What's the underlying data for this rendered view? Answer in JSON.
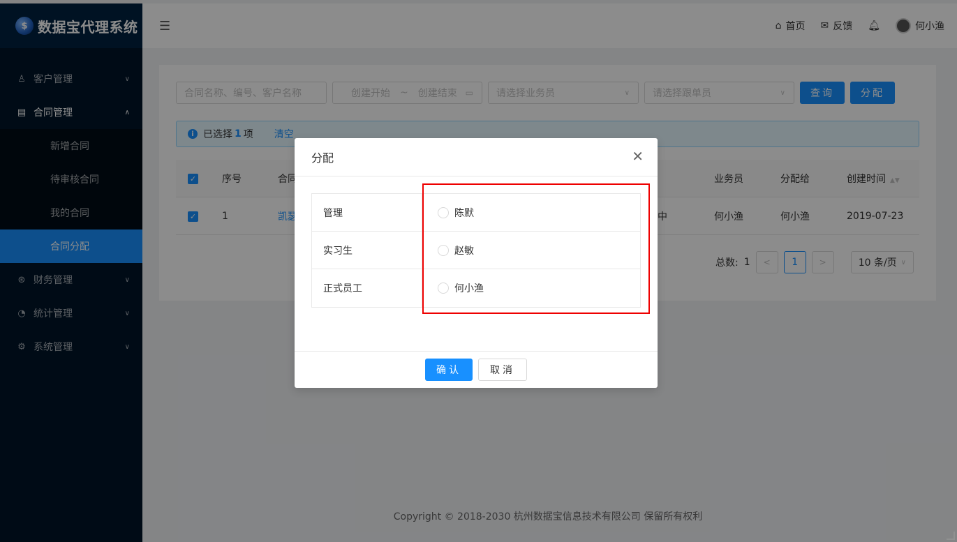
{
  "app": {
    "logo_text": "数据宝代理系统",
    "logo_mark": "$"
  },
  "sidebar": {
    "items": [
      {
        "label": "客户管理",
        "icon": "user-icon"
      },
      {
        "label": "合同管理",
        "icon": "contract-icon"
      },
      {
        "label": "财务管理",
        "icon": "finance-icon"
      },
      {
        "label": "统计管理",
        "icon": "chart-icon"
      },
      {
        "label": "系统管理",
        "icon": "gear-icon"
      }
    ],
    "contract_sub": [
      "新增合同",
      "待审核合同",
      "我的合同",
      "合同分配"
    ]
  },
  "header": {
    "home": "首页",
    "feedback": "反馈",
    "user": "何小渔"
  },
  "filters": {
    "search_placeholder": "合同名称、编号、客户名称",
    "date_start": "创建开始",
    "date_sep": "~",
    "date_end": "创建结束",
    "salesman_placeholder": "请选择业务员",
    "follower_placeholder": "请选择跟单员",
    "query_label": "查询",
    "assign_label": "分配"
  },
  "alert": {
    "prefix": "已选择",
    "count": "1",
    "suffix": "项",
    "clear": "清空"
  },
  "table": {
    "headers": {
      "index": "序号",
      "name": "合同",
      "salesman": "业务员",
      "assigned_to": "分配给",
      "created": "创建时间"
    },
    "rows": [
      {
        "index": "1",
        "name": "凯瑟",
        "status": "中",
        "salesman": "何小渔",
        "assigned_to": "何小渔",
        "created": "2019-07-23"
      }
    ]
  },
  "pagination": {
    "total_label": "总数:",
    "total": "1",
    "current": "1",
    "size": "10 条/页"
  },
  "footer": {
    "copyright": "Copyright © 2018-2030 杭州数据宝信息技术有限公司 保留所有权利"
  },
  "modal": {
    "title": "分配",
    "options": [
      {
        "group": "管理",
        "person": "陈默"
      },
      {
        "group": "实习生",
        "person": "赵敏"
      },
      {
        "group": "正式员工",
        "person": "何小渔"
      }
    ],
    "ok_label": "确认",
    "cancel_label": "取消"
  },
  "colors": {
    "primary": "#1890ff",
    "sidebar": "#001529",
    "highlight": "#e00000"
  }
}
